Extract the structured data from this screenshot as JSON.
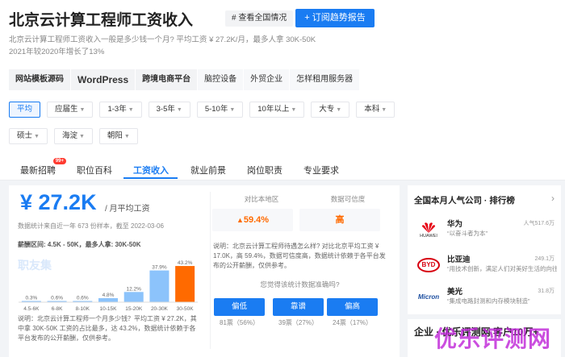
{
  "header": {
    "title": "北京云计算工程师工资收入",
    "national_btn": "# 查看全国情况",
    "subscribe_btn": "+ 订阅趋势报告",
    "intro_line1": "北京云计算工程师工资收入一般是多少钱一个月? 平均工资 ¥ 27.2K/月，最多人拿 30K-50K",
    "intro_line2": "2021年较2020年增长了13%"
  },
  "categories": [
    "网站模板源码",
    "WordPress",
    "跨境电商平台",
    "脑控设备",
    "外贸企业",
    "怎样租用服务器"
  ],
  "filters": {
    "row1": [
      "平均",
      "应届生",
      "1-3年",
      "3-5年",
      "5-10年",
      "10年以上",
      "大专",
      "本科",
      "硕士"
    ],
    "row2": [
      "海淀",
      "朝阳"
    ]
  },
  "tabs": [
    "最新招聘",
    "职位百科",
    "工资收入",
    "就业前景",
    "岗位职责",
    "专业要求"
  ],
  "badge": "99+",
  "salary": {
    "value": "¥ 27.2K",
    "unit": "/ 月平均工资",
    "note": "数据统计来自近一年 673 份样本，截至 2022-03-06",
    "range": "薪酬区间: 4.5K - 50K，最多人拿: 30K-50K",
    "watermark": "职友集",
    "desc": "说明：北京云计算工程师一个月多少钱？平均工资 ¥ 27.2K，其中拿 30K-50K 工资的占比最多，达 43.2%，数据统计依赖于各平台发布的公开薪酬，仅供参考。"
  },
  "chart_data": {
    "type": "bar",
    "categories": [
      "4.5-6K",
      "6-8K",
      "8-10K",
      "10-15K",
      "15-20K",
      "20-30K",
      "30-50K"
    ],
    "values": [
      0.3,
      0.6,
      0.6,
      4.8,
      12.2,
      37.9,
      43.2
    ],
    "labels": [
      "0.3%",
      "0.6%",
      "0.6%",
      "4.8%",
      "12.2%",
      "37.9%",
      "43.2%"
    ],
    "colors": {
      "normal": "#8cc3fb",
      "highlight": "#ff6a00"
    },
    "ylim": [
      0,
      50
    ]
  },
  "compare": {
    "label": "对比本地区",
    "value": "59.4%",
    "icon": "trend-up-icon",
    "trust_label": "数据可信度",
    "trust_value": "高",
    "text": "说明：北京云计算工程师待遇怎么样? 对比北京平均工资 ¥ 17.0K，高 59.4%，数据可信度高，数据统计依赖于各平台发布的公开薪酬，仅供参考。"
  },
  "vote": {
    "question": "您觉得该统计数据准确吗?",
    "options": [
      {
        "label": "偏低",
        "count": "81票（56%）"
      },
      {
        "label": "靠谱",
        "count": "39票（27%）"
      },
      {
        "label": "偏高",
        "count": "24票（17%）"
      }
    ]
  },
  "sidebar": {
    "title": "全国本月人气公司 · 排行榜",
    "companies": [
      {
        "name": "华为",
        "logo": "HUAWEI",
        "slogan": "“以奋斗者为本”",
        "popularity": "人气517.6万"
      },
      {
        "name": "比亚迪",
        "logo": "BYD",
        "slogan": "“用技术创新，满足人们对美好生活的向往”",
        "popularity": "249.1万"
      },
      {
        "name": "美光",
        "logo": "Micron",
        "slogan": "“集成电路封测和内存模块制造”",
        "popularity": "31.8万"
      }
    ]
  },
  "bottom_card": {
    "text": "企业 · 优乐评测网 客户10万+"
  },
  "watermark_big": "优乐评测网"
}
